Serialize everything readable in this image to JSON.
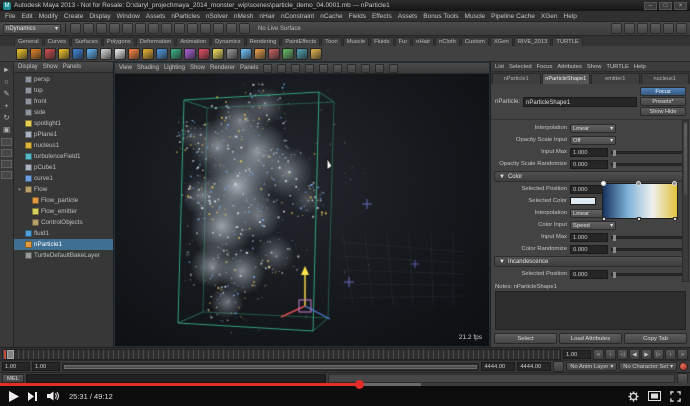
{
  "window": {
    "title": "Autodesk Maya 2013 - Not for Resale: D:\\daryl_project\\maya_2014_monster_wip\\scenes\\particle_demo_04.0001.mb --- nParticle1"
  },
  "menus": [
    "File",
    "Edit",
    "Modify",
    "Create",
    "Display",
    "Window",
    "Assets",
    "nParticles",
    "nSolver",
    "nMesh",
    "nHair",
    "nConstraint",
    "nCache",
    "Fields",
    "Effects",
    "Assets",
    "Bonus Tools",
    "Muscle",
    "Pipeline Cache",
    "XGen",
    "Help"
  ],
  "toolbar": {
    "menuset": "nDynamics",
    "live_surface": "No Live Surface",
    "left_icons": [
      "new-scene-icon",
      "open-scene-icon",
      "save-scene-icon",
      "undo-icon",
      "redo-icon",
      "select-hierarchy-icon",
      "select-object-icon",
      "select-component-icon",
      "snap-grid-icon",
      "snap-curve-icon",
      "snap-point-icon",
      "snap-plane-icon",
      "make-live-icon",
      "construction-history-icon"
    ],
    "right_icons": [
      "render-view-icon",
      "render-current-frame-icon",
      "ipr-render-icon",
      "render-settings-icon",
      "paint-effects-icon",
      "hypershade-icon"
    ]
  },
  "shelf_tabs": [
    "General",
    "Curves",
    "Surfaces",
    "Polygons",
    "Deformation",
    "Animation",
    "Dynamics",
    "Rendering",
    "PaintEffects",
    "Toon",
    "Muscle",
    "Fluids",
    "Fur",
    "nHair",
    "nCloth",
    "Custom",
    "XGen",
    "RIVE_2013",
    "TURTLE"
  ],
  "shelf_icons": [
    "#d8b02a",
    "#c87828",
    "#b84848",
    "#d8b02a",
    "#3a78c0",
    "#58a0d8",
    "#c0c0c0",
    "#d8d8d8",
    "#e07840",
    "#d0a030",
    "#4888c8",
    "#38a078",
    "#9858c0",
    "#c84858",
    "#d8c858",
    "#888888",
    "#68b0e0",
    "#d09048",
    "#b05858",
    "#60a860",
    "#4a90a0",
    "#caa24a"
  ],
  "toolbox": {
    "tools": [
      {
        "name": "select-tool",
        "glyph": "►"
      },
      {
        "name": "lasso-tool",
        "glyph": "○"
      },
      {
        "name": "paint-select-tool",
        "glyph": "✎"
      },
      {
        "name": "move-tool",
        "glyph": "+"
      },
      {
        "name": "rotate-tool",
        "glyph": "↻"
      },
      {
        "name": "scale-tool",
        "glyph": "▣"
      }
    ],
    "layouts": [
      "single-pane-layout",
      "four-pane-layout",
      "persp-outliner-layout",
      "hypershade-persp-layout"
    ]
  },
  "outliner": {
    "menus": [
      "Display",
      "Show",
      "Panels"
    ],
    "icon_colors": {
      "camera": "#8f959c",
      "light": "#e3cf53",
      "mesh": "#a9b4c0",
      "nucleus": "#d8b23a",
      "field": "#58b8c8",
      "curve": "#6f9fdf",
      "group": "#b9a06a",
      "particle": "#e09a40",
      "emitter": "#d8d05a",
      "fluid": "#4fa0d8",
      "layer": "#999999"
    },
    "items": [
      {
        "label": "persp",
        "icon": "camera",
        "indent": 0
      },
      {
        "label": "top",
        "icon": "camera",
        "indent": 0
      },
      {
        "label": "front",
        "icon": "camera",
        "indent": 0
      },
      {
        "label": "side",
        "icon": "camera",
        "indent": 0
      },
      {
        "label": "spotlight1",
        "icon": "light",
        "indent": 0
      },
      {
        "label": "pPlane1",
        "icon": "mesh",
        "indent": 0
      },
      {
        "label": "nucleus1",
        "icon": "nucleus",
        "indent": 0
      },
      {
        "label": "turbulenceField1",
        "icon": "field",
        "indent": 0
      },
      {
        "label": "pCube1",
        "icon": "mesh",
        "indent": 0
      },
      {
        "label": "curve1",
        "icon": "curve",
        "indent": 0
      },
      {
        "label": "Flow",
        "icon": "group",
        "indent": 0,
        "expanded": true
      },
      {
        "label": "Flow_particle",
        "icon": "particle",
        "indent": 1
      },
      {
        "label": "Flow_emitter",
        "icon": "emitter",
        "indent": 1
      },
      {
        "label": "ControlObjects",
        "icon": "group",
        "indent": 1
      },
      {
        "label": "fluid1",
        "icon": "fluid",
        "indent": 0
      },
      {
        "label": "nParticle1",
        "icon": "particle",
        "indent": 0,
        "selected": true
      },
      {
        "label": "TurtleDefaultBakeLayer",
        "icon": "layer",
        "indent": 0
      }
    ]
  },
  "viewport": {
    "menus": [
      "View",
      "Shading",
      "Lighting",
      "Show",
      "Renderer",
      "Panels"
    ],
    "fps": "21.2 fps"
  },
  "attribute_editor": {
    "menus": [
      "List",
      "Selected",
      "Focus",
      "Attributes",
      "Show",
      "TURTLE",
      "Help"
    ],
    "tabs": [
      {
        "label": "nParticle1",
        "active": false
      },
      {
        "label": "nParticleShape1",
        "active": true
      },
      {
        "label": "emitter1",
        "active": false
      },
      {
        "label": "nucleus1",
        "active": false
      }
    ],
    "object_label": "nParticle:",
    "object_name": "nParticleShape1",
    "buttons": {
      "focus": "Focus",
      "presets": "Presets*",
      "showhide": "Show Hide"
    },
    "rows": [
      {
        "label": "Interpolation",
        "control": "dropdown",
        "value": "Linear"
      },
      {
        "label": "Opacity Scale Input",
        "control": "dropdown",
        "value": "Off"
      },
      {
        "label": "Input Max",
        "control": "field",
        "value": "1.000",
        "slider": true
      },
      {
        "label": "Opacity Scale Randomize",
        "control": "field",
        "value": "0.000",
        "slider": true
      },
      {
        "type": "section",
        "label": "Color"
      },
      {
        "label": "Selected Position",
        "control": "field",
        "value": "0.000",
        "short": true,
        "ramp": true
      },
      {
        "label": "Selected Color",
        "control": "color",
        "short": true
      },
      {
        "label": "Interpolation",
        "control": "dropdown",
        "value": "Linear",
        "short": true
      },
      {
        "label": "Color Input",
        "control": "dropdown",
        "value": "Speed"
      },
      {
        "label": "Input Max",
        "control": "field",
        "value": "1.000",
        "slider": true
      },
      {
        "label": "Color Randomize",
        "control": "field",
        "value": "0.000",
        "slider": true
      },
      {
        "type": "section",
        "label": "Incandescence"
      },
      {
        "label": "Selected Position",
        "control": "field",
        "value": "0.000",
        "slider": true
      }
    ],
    "ramp": {
      "colors": [
        "#16335e",
        "#7fb2d9",
        "#eef0ee",
        "#e2c23a"
      ],
      "stops": [
        2,
        48,
        97
      ]
    },
    "selected_color": "#dfe9f2",
    "notes_label": "Notes: nParticleShape1",
    "footer_buttons": [
      "Select",
      "Load Attributes",
      "Copy Tab"
    ]
  },
  "timeline": {
    "current": "1.00",
    "range_start_a": "1.00",
    "range_start_b": "1.00",
    "range_end_a": "4444.00",
    "range_end_b": "4444.00",
    "anim_layer": "No Anim Layer",
    "character_set": "No Character Set",
    "transport": [
      {
        "name": "go-to-start-button",
        "glyph": "«"
      },
      {
        "name": "step-back-frame-button",
        "glyph": "‹"
      },
      {
        "name": "step-back-key-button",
        "glyph": "◁"
      },
      {
        "name": "play-backwards-button",
        "glyph": "◀"
      },
      {
        "name": "play-forwards-button",
        "glyph": "▶"
      },
      {
        "name": "step-forward-key-button",
        "glyph": "▷"
      },
      {
        "name": "step-forward-frame-button",
        "glyph": "›"
      },
      {
        "name": "go-to-end-button",
        "glyph": "»"
      }
    ]
  },
  "command_line": {
    "label": "MEL"
  },
  "player": {
    "time": "25:31 / 49:12",
    "progress_pct": 52,
    "buffer_pct": 61,
    "accent_color": "#e52d27"
  }
}
